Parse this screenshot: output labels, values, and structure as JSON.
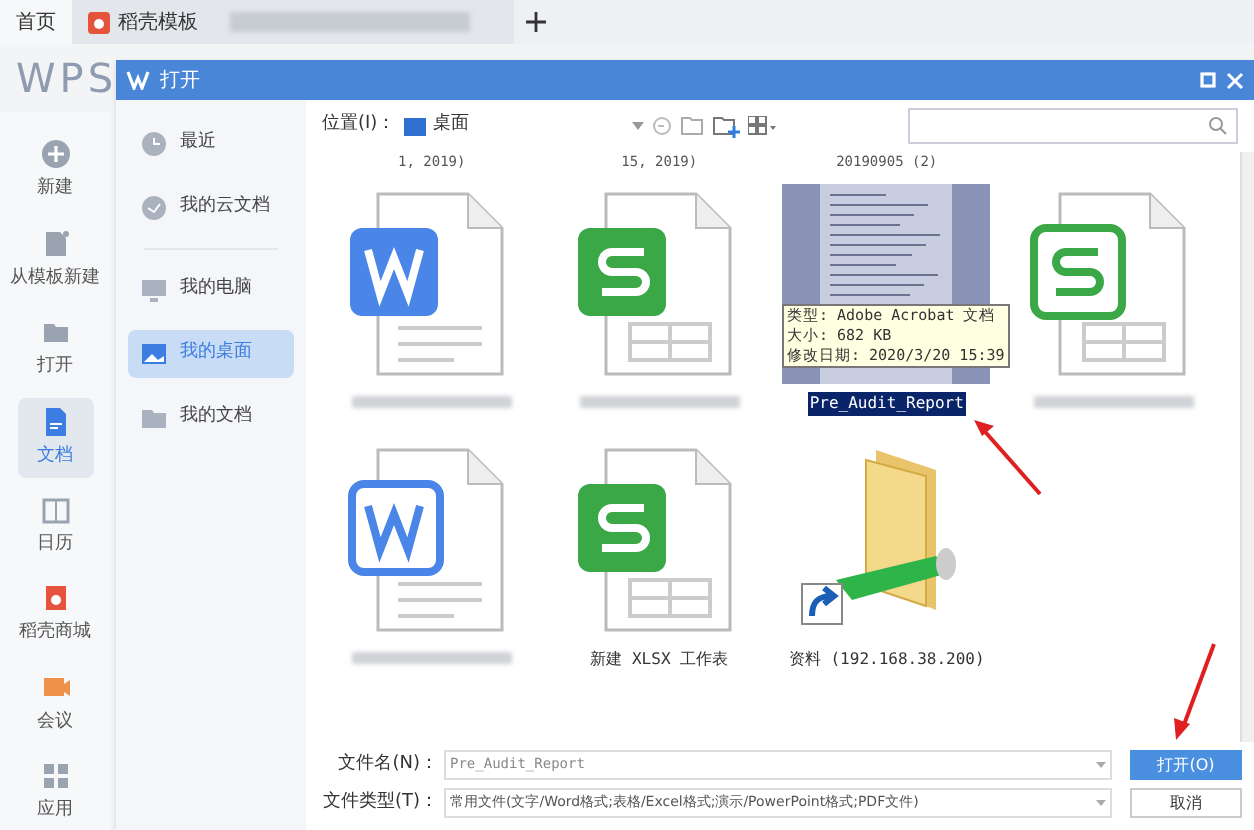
{
  "top_tabs": [
    {
      "kind": "home",
      "label": "首页",
      "selected": true
    },
    {
      "kind": "template",
      "label": "稻壳模板",
      "selected": false
    },
    {
      "kind": "blurred",
      "selected": false
    }
  ],
  "app_logo": "WPS",
  "rail": [
    {
      "kind": "plus",
      "label": "新建",
      "selected": false
    },
    {
      "kind": "template",
      "label": "从模板新建",
      "selected": false
    },
    {
      "kind": "folder",
      "label": "打开",
      "selected": false
    },
    {
      "kind": "doc",
      "label": "文档",
      "selected": true
    },
    {
      "kind": "calendar",
      "label": "日历",
      "selected": false
    },
    {
      "kind": "store",
      "label": "稻壳商城",
      "selected": false
    },
    {
      "kind": "meeting",
      "label": "会议",
      "selected": false
    },
    {
      "kind": "apps",
      "label": "应用",
      "selected": false
    }
  ],
  "dialog": {
    "title": "打开",
    "places": [
      {
        "kind": "clock",
        "label": "最近",
        "selected": false
      },
      {
        "kind": "cloud",
        "label": "我的云文档",
        "selected": false
      },
      {
        "kind": "monitor",
        "label": "我的电脑",
        "selected": false
      },
      {
        "kind": "desktop",
        "label": "我的桌面",
        "selected": true
      },
      {
        "kind": "folder",
        "label": "我的文档",
        "selected": false
      }
    ],
    "location_label": "位置(I)：",
    "location": "桌面",
    "partial_row_labels": [
      "1, 2019)",
      "15, 2019)",
      "20190905 (2)"
    ],
    "files": [
      {
        "kind": "word",
        "selected": false
      },
      {
        "kind": "sheet",
        "selected": false
      },
      {
        "kind": "pdf",
        "name": "Pre_Audit_Report",
        "selected": true
      },
      {
        "kind": "sheet_outline",
        "selected": false
      },
      {
        "kind": "word_outline",
        "selected": false
      },
      {
        "kind": "sheet",
        "name": "新建 XLSX 工作表",
        "selected": false
      },
      {
        "kind": "folder_shortcut",
        "name": "资料 (192.168.38.200)",
        "selected": false
      }
    ],
    "tooltip": [
      "类型: Adobe Acrobat 文档",
      "大小: 682 KB",
      "修改日期: 2020/3/20 15:39"
    ],
    "filename_label": "文件名(N)：",
    "filename": "Pre_Audit_Report",
    "filetype_label": "文件类型(T)：",
    "filetype": "常用文件(文字/Word格式;表格/Excel格式;演示/PowerPoint格式;PDF文件)",
    "open_button": "打开(O)",
    "cancel_button": "取消"
  }
}
